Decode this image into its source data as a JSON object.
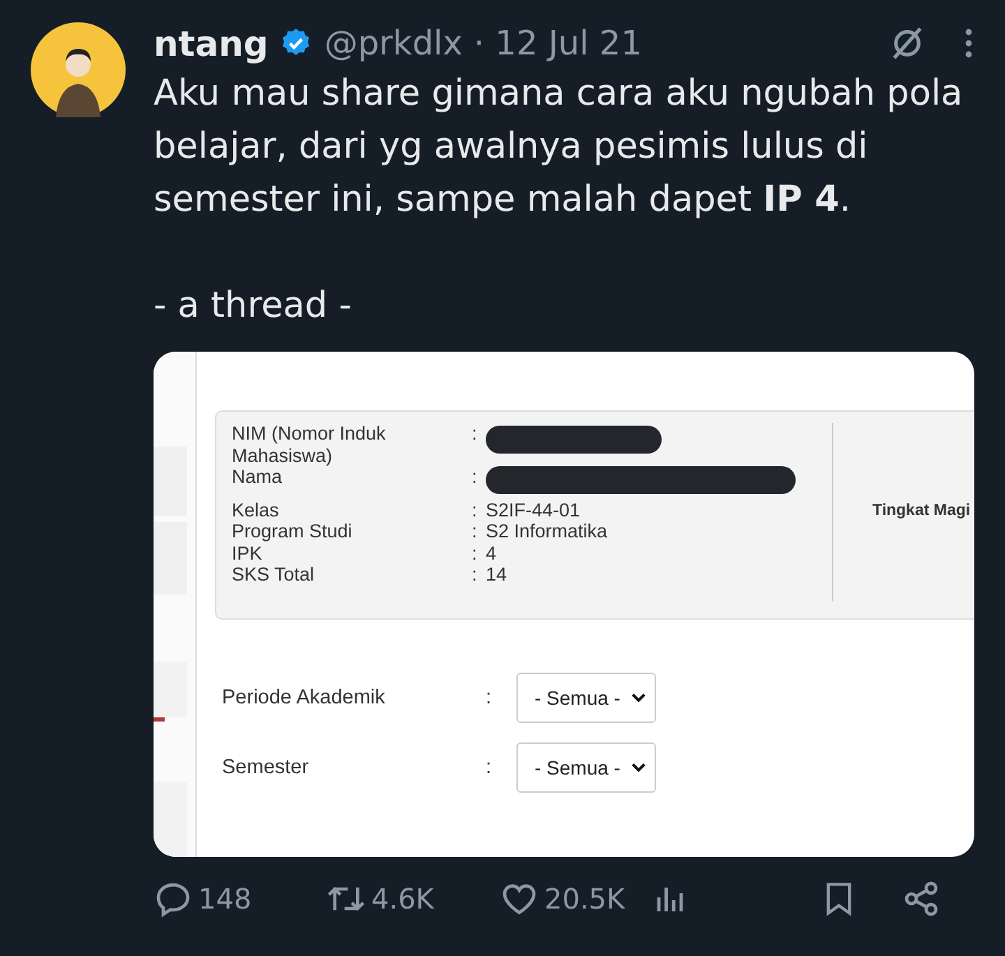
{
  "tweet": {
    "author": {
      "name": "ntang",
      "verified": true,
      "handle": "@prkdlx",
      "date": "· 12 Jul 21"
    },
    "paragraphs": [
      "Aku mau share gimana cara aku ngubah pola belajar, dari yg awalnya pesimis lulus di semester ini, sampe malah dapet **IP 4**.",
      "- a thread -"
    ],
    "attachment": {
      "info_rows": [
        {
          "label": "NIM (Nomor Induk Mahasiswa)",
          "colon": ":",
          "kind": "redacted"
        },
        {
          "label": "Nama",
          "colon": ":",
          "kind": "redacted"
        },
        {
          "label": "Kelas",
          "colon": ":",
          "kind": "text",
          "value": "S2IF-44-01"
        },
        {
          "label": "Program Studi",
          "colon": ":",
          "kind": "text",
          "value": "S2 Informatika"
        },
        {
          "label": "IPK",
          "colon": ":",
          "kind": "text",
          "value": "4"
        },
        {
          "label": "SKS Total",
          "colon": ":",
          "kind": "text",
          "value": "14"
        }
      ],
      "side_label": "Tingkat Magi",
      "filters": [
        {
          "label": "Periode Akademik",
          "colon": ":",
          "value": "- Semua -"
        },
        {
          "label": "Semester",
          "colon": ":",
          "value": "- Semua -"
        }
      ]
    },
    "actions": {
      "replies": "148",
      "reposts": "4.6K",
      "likes": "20.5K"
    }
  }
}
